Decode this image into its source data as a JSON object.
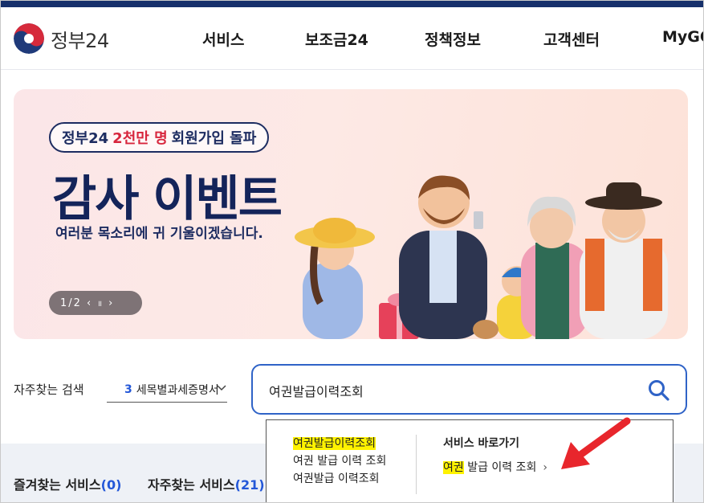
{
  "header": {
    "logo_text": "정부24",
    "nav": [
      {
        "label": "서비스"
      },
      {
        "label": "보조금24"
      },
      {
        "label": "정책정보"
      },
      {
        "label": "고객센터"
      },
      {
        "label": "MyGOV"
      }
    ]
  },
  "banner": {
    "pill_prefix": "정부24",
    "pill_accent": "2천만 명",
    "pill_suffix": "회원가입 돌파",
    "headline": "감사 이벤트",
    "subline": "여러분 목소리에 귀 기울이겠습니다.",
    "pager": {
      "current": "1",
      "separator": "/",
      "total": "2",
      "prev_glyph": "‹",
      "pause_glyph": "॥",
      "next_glyph": "›"
    }
  },
  "search": {
    "frequent_label": "자주찾는 검색",
    "frequent_rank": "3",
    "frequent_term": "세목별과세증명서",
    "query": "여권발급이력조회",
    "search_icon": "search-icon"
  },
  "autocomplete": {
    "suggestions": [
      {
        "highlight": "여권발급이력조회",
        "rest": ""
      },
      {
        "highlight": "",
        "rest": "여권 발급 이력 조회"
      },
      {
        "highlight": "",
        "rest": "여권발급 이력조회"
      }
    ],
    "shortcut_heading": "서비스 바로가기",
    "shortcut": {
      "highlight": "여권",
      "rest": " 발급 이력 조회",
      "arrow": "›"
    }
  },
  "lower": {
    "favorites_label": "즐겨찾는 서비스",
    "favorites_count": "(0)",
    "frequent_label": "자주찾는 서비스",
    "frequent_count": "(21)"
  },
  "colors": {
    "brand_navy": "#16306b",
    "accent_red": "#d7263d",
    "search_border": "#2f63c7",
    "highlight": "#fff200",
    "annotation_arrow": "#e8262c"
  }
}
